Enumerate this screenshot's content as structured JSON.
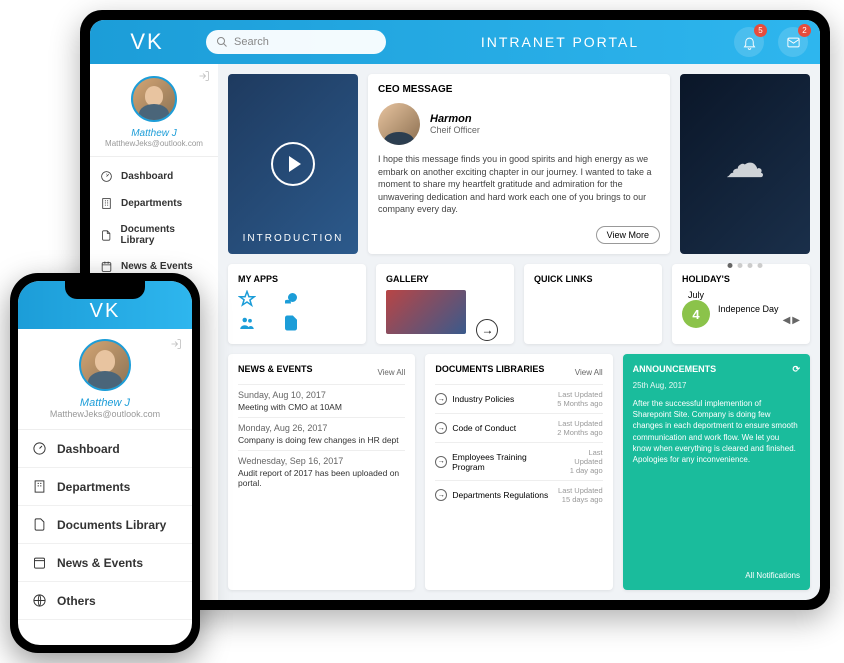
{
  "brand": "VK",
  "header": {
    "search_placeholder": "Search",
    "title": "INTRANET PORTAL",
    "notif_count": "5",
    "mail_count": "2"
  },
  "user": {
    "name": "Matthew J",
    "email": "MatthewJeks@outlook.com"
  },
  "nav": {
    "dashboard": "Dashboard",
    "departments": "Departments",
    "documents": "Documents Library",
    "news": "News & Events",
    "others": "Others"
  },
  "intro": {
    "label": "INTRODUCTION"
  },
  "ceo": {
    "heading": "CEO MESSAGE",
    "name": "Harmon",
    "role": "Cheif Officer",
    "message": "I hope this message finds you in good spirits and high energy as we embark on another exciting chapter in our journey. I wanted to take a moment to share my heartfelt gratitude and admiration for the unwavering dedication and hard work each one of you brings to our company every day.",
    "view_more": "View More"
  },
  "myapps": {
    "label": "MY APPS"
  },
  "gallery": {
    "label": "GALLERY"
  },
  "quicklinks": {
    "label": "QUICK LINKS"
  },
  "holiday": {
    "label": "HOLIDAY'S",
    "month": "July",
    "day": "4",
    "name": "Indepence Day"
  },
  "news_events": {
    "label": "NEWS & EVENTS",
    "view_all": "View All",
    "items": [
      {
        "date": "Sunday, Aug 10, 2017",
        "text": "Meeting with CMO at 10AM"
      },
      {
        "date": "Monday, Aug 26, 2017",
        "text": "Company is doing few changes in HR dept"
      },
      {
        "date": "Wednesday, Sep 16, 2017",
        "text": "Audit report of 2017 has been uploaded on portal."
      }
    ]
  },
  "docs": {
    "label": "DOCUMENTS LIBRARIES",
    "view_all": "View All",
    "last_updated": "Last Updated",
    "items": [
      {
        "name": "Industry Policies",
        "ago": "5 Months ago"
      },
      {
        "name": "Code of Conduct",
        "ago": "2 Months ago"
      },
      {
        "name": "Employees Training Program",
        "ago": "1 day ago"
      },
      {
        "name": "Departments Regulations",
        "ago": "15 days ago"
      }
    ]
  },
  "ann": {
    "label": "ANNOUNCEMENTS",
    "date": "25th Aug, 2017",
    "body": "After the successful implemention of Sharepoint Site. Company is doing few changes in each deportment to ensure smooth communication and work flow. We let you know when everything is cleared and finished. Apologies for any inconvenience.",
    "all": "All Notifications"
  }
}
